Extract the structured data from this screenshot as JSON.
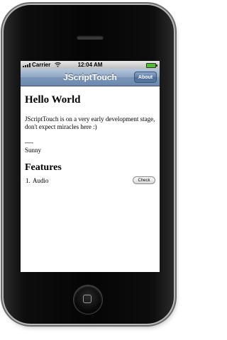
{
  "status_bar": {
    "carrier": "Carrier",
    "time": "12:04 AM"
  },
  "nav_bar": {
    "title": "JScriptTouch",
    "about_label": "About"
  },
  "content": {
    "heading": "Hello World",
    "intro": "JScriptTouch is on a very early development stage, don't expect miracles here :)",
    "signature_separator": "----",
    "signature_name": "Sunny",
    "features_heading": "Features",
    "features": [
      {
        "number": "1.",
        "name": "Audio",
        "button_label": "Check"
      }
    ]
  },
  "icons": {
    "signal": "signal-bars-icon",
    "wifi": "wifi-icon",
    "battery": "battery-icon",
    "home": "home-button-icon",
    "speaker": "earpiece-speaker-icon"
  },
  "colors": {
    "navbar": "#7a95b8",
    "battery": "#4fbf2f",
    "phone_body": "#050505"
  }
}
